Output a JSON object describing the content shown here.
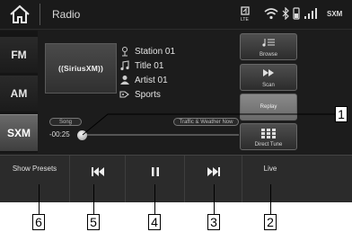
{
  "statusbar": {
    "title": "Radio",
    "sxm_label": "SXM",
    "icons": [
      "home-icon",
      "lte-icon",
      "wifi-icon",
      "bluetooth-icon",
      "phone-icon",
      "signal-icon"
    ]
  },
  "bands": [
    {
      "label": "FM",
      "active": false
    },
    {
      "label": "AM",
      "active": false
    },
    {
      "label": "SXM",
      "active": true
    }
  ],
  "logo": {
    "text": "((SiriusXM))"
  },
  "metadata": {
    "station": "Station 01",
    "title": "Title 01",
    "artist": "Artist 01",
    "category": "Sports"
  },
  "right_buttons": {
    "browse": "Browse",
    "scan": "Scan",
    "replay": "Replay",
    "direct_tune": "Direct Tune"
  },
  "pills": {
    "song": "Song",
    "traffic": "Traffic & Weather Now"
  },
  "playback": {
    "time": "-00:25"
  },
  "bottom": {
    "show_presets": "Show Presets",
    "live": "Live"
  },
  "callouts": {
    "c1": "1",
    "c2": "2",
    "c3": "3",
    "c4": "4",
    "c5": "5",
    "c6": "6"
  }
}
